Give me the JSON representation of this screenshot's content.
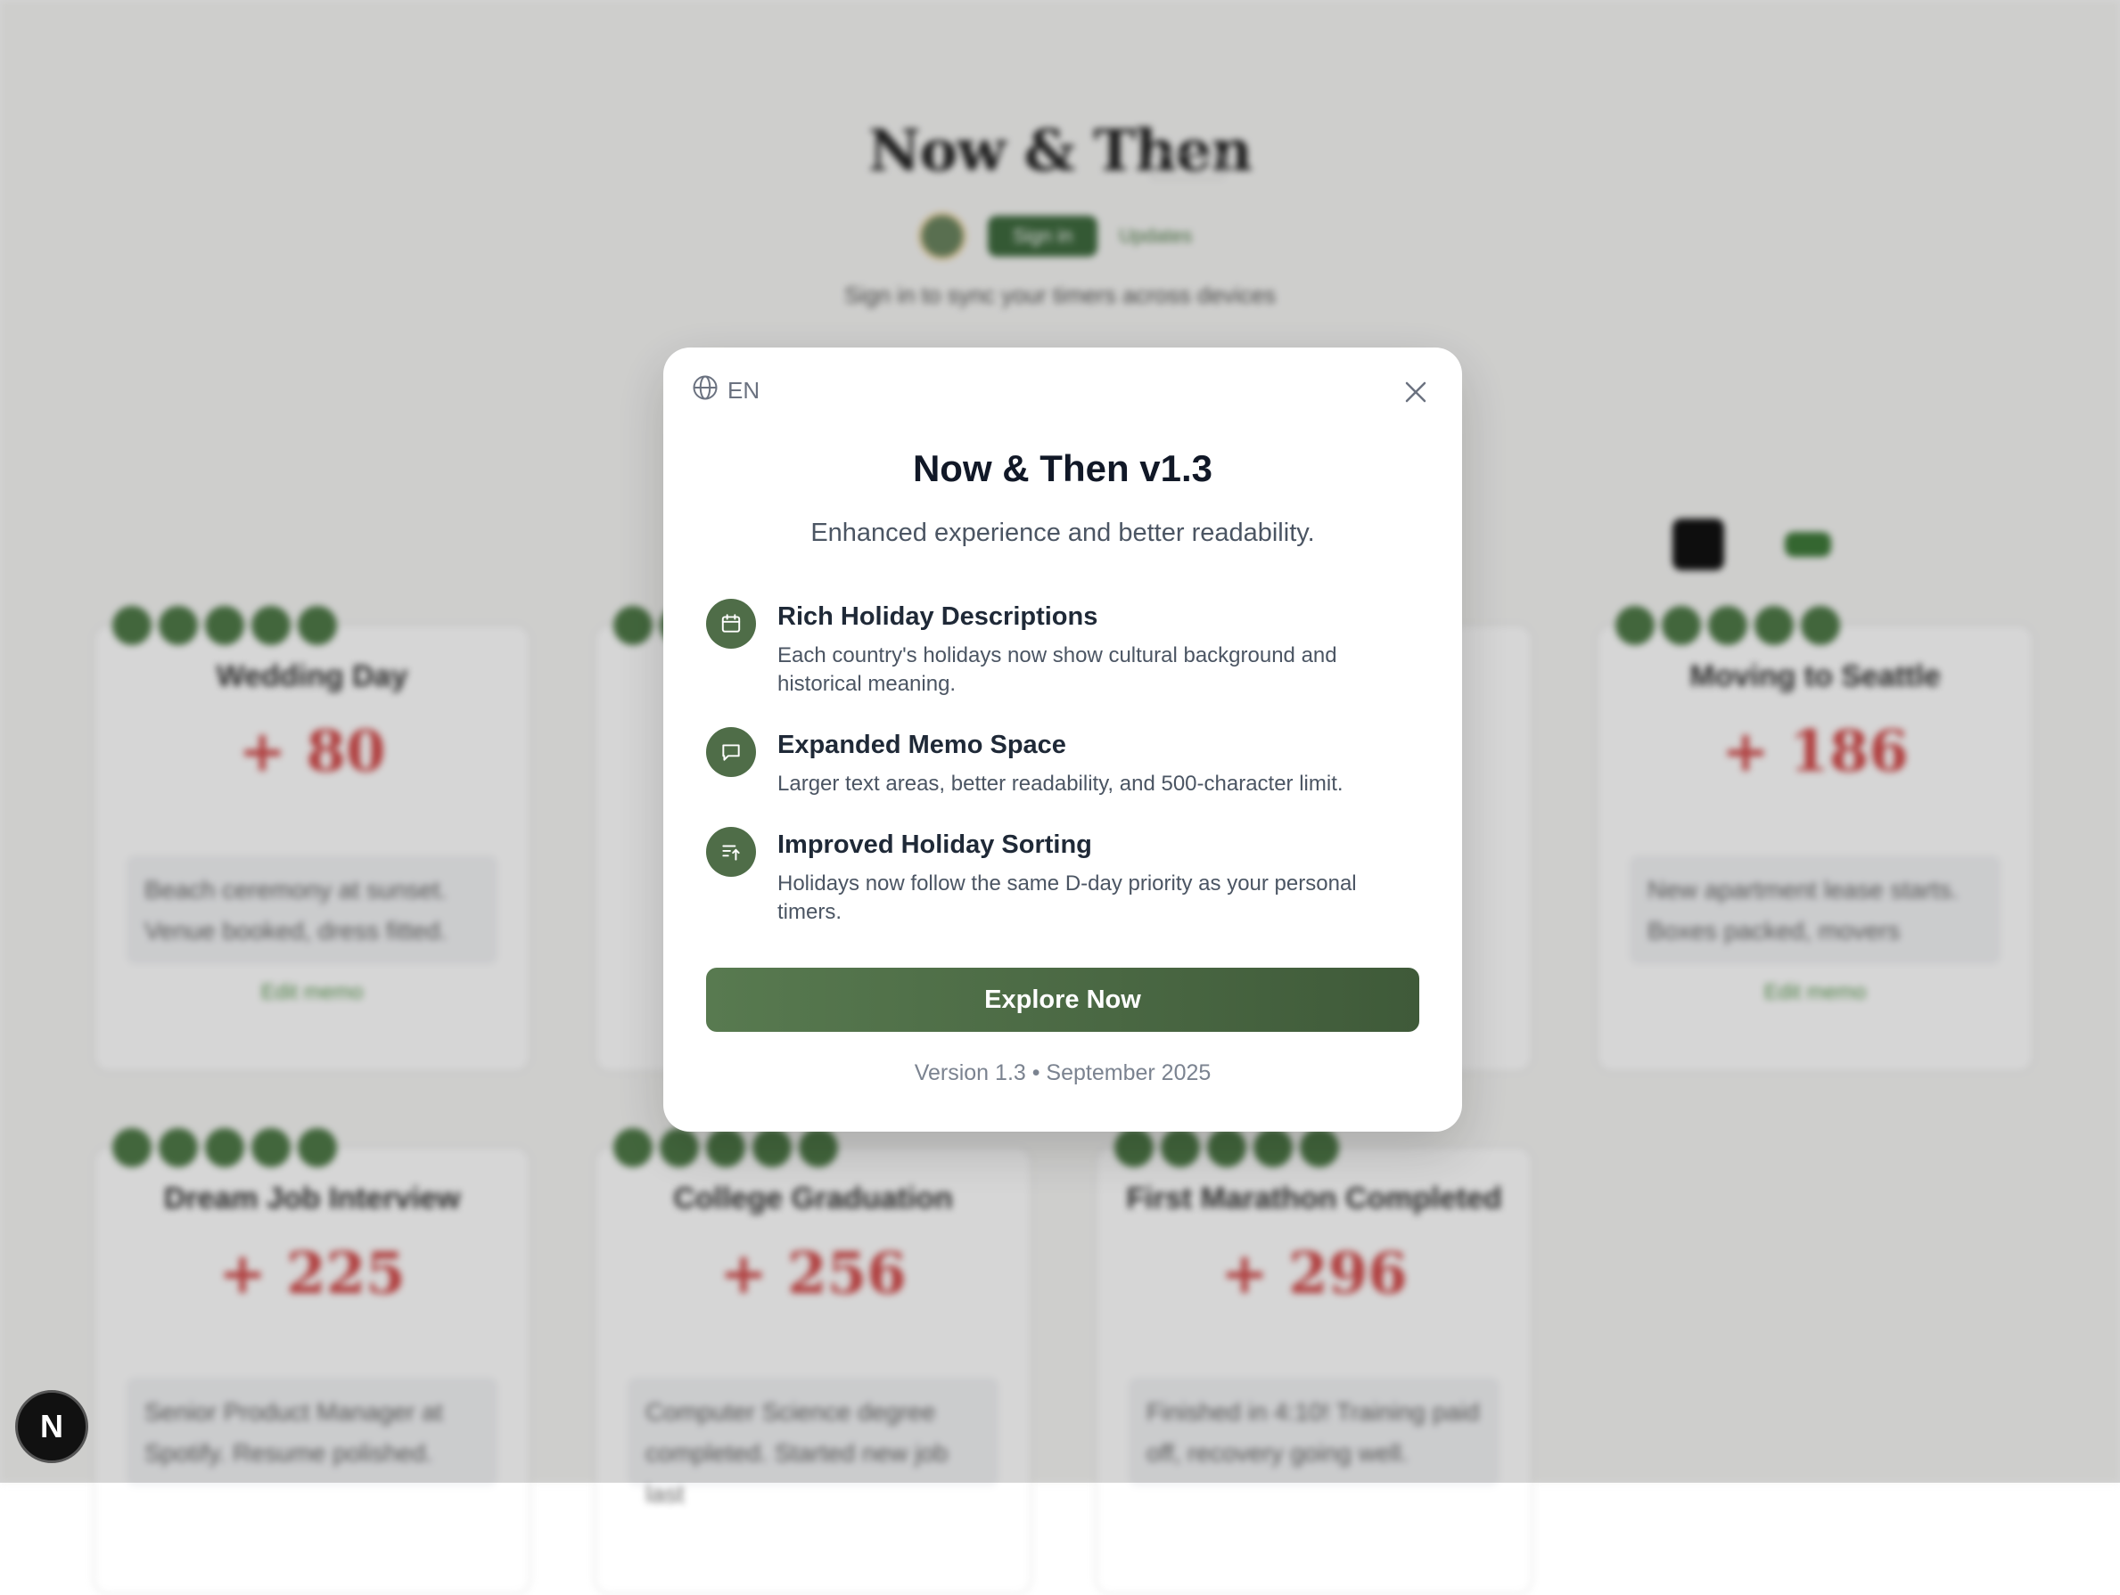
{
  "background": {
    "app_title": "Now & Then",
    "signin_text": "Sign in to sync your timers across devices",
    "signin_button": "Sign in",
    "updates_link": "Updates",
    "cards": [
      {
        "title": "Wedding Day",
        "value": "+ 80",
        "memo": "Beach ceremony at sunset. Venue booked, dress fitted.",
        "edit": "Edit memo"
      },
      {
        "title": "Moving to Seattle",
        "value": "+ 186",
        "memo": "New apartment lease starts. Boxes packed, movers",
        "edit": "Edit memo"
      },
      {
        "title": "Dream Job Interview",
        "value": "+ 225",
        "memo": "Senior Product Manager at Spotify. Resume polished."
      },
      {
        "title": "College Graduation",
        "value": "+ 256",
        "memo": "Computer Science degree completed. Started new job last"
      },
      {
        "title": "First Marathon Completed",
        "value": "+ 296",
        "memo": "Finished in 4:10! Training paid off, recovery going well."
      }
    ]
  },
  "modal": {
    "language": "EN",
    "title": "Now & Then v1.3",
    "subtitle": "Enhanced experience and better readability.",
    "features": [
      {
        "icon": "calendar-icon",
        "title": "Rich Holiday Descriptions",
        "description": "Each country's holidays now show cultural background and historical meaning."
      },
      {
        "icon": "message-icon",
        "title": "Expanded Memo Space",
        "description": "Larger text areas, better readability, and 500-character limit."
      },
      {
        "icon": "sort-icon",
        "title": "Improved Holiday Sorting",
        "description": "Holidays now follow the same D-day priority as your personal timers."
      }
    ],
    "cta_label": "Explore Now",
    "version_text": "Version 1.3 • September 2025"
  },
  "next_badge": "N",
  "colors": {
    "accent": "#4f6d48",
    "cta_start": "#587a50",
    "cta_end": "#3f5a39"
  }
}
